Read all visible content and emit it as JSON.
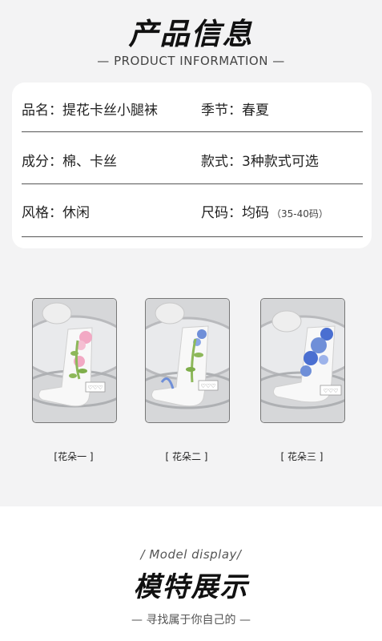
{
  "header": {
    "title": "产品信息",
    "subtitle": "— PRODUCT INFORMATION —"
  },
  "info": {
    "rows": [
      {
        "left": "品名：提花卡丝小腿袜",
        "right": "季节：春夏",
        "right_note": ""
      },
      {
        "left": "成分：棉、卡丝",
        "right": "款式：3种款式可选",
        "right_note": ""
      },
      {
        "left": "风格：休闲",
        "right": "尺码：均码",
        "right_note": "（35-40码）"
      }
    ]
  },
  "products": [
    {
      "label": "[花朵一 ]",
      "pattern": "pink-flower-green-leaves",
      "accent": "#f2a9c4"
    },
    {
      "label": "[ 花朵二 ]",
      "pattern": "blue-flower-green-leaves",
      "accent": "#6f8fd8"
    },
    {
      "label": "[ 花朵三 ]",
      "pattern": "blue-blooms",
      "accent": "#4a6fd1"
    }
  ],
  "model_section": {
    "english": "/ Model display/",
    "title": "模特展示",
    "subtitle": "— 寻找属于你自己的 —"
  },
  "colors": {
    "background": "#f3f3f4",
    "card": "#ffffff",
    "divider": "#555555"
  }
}
